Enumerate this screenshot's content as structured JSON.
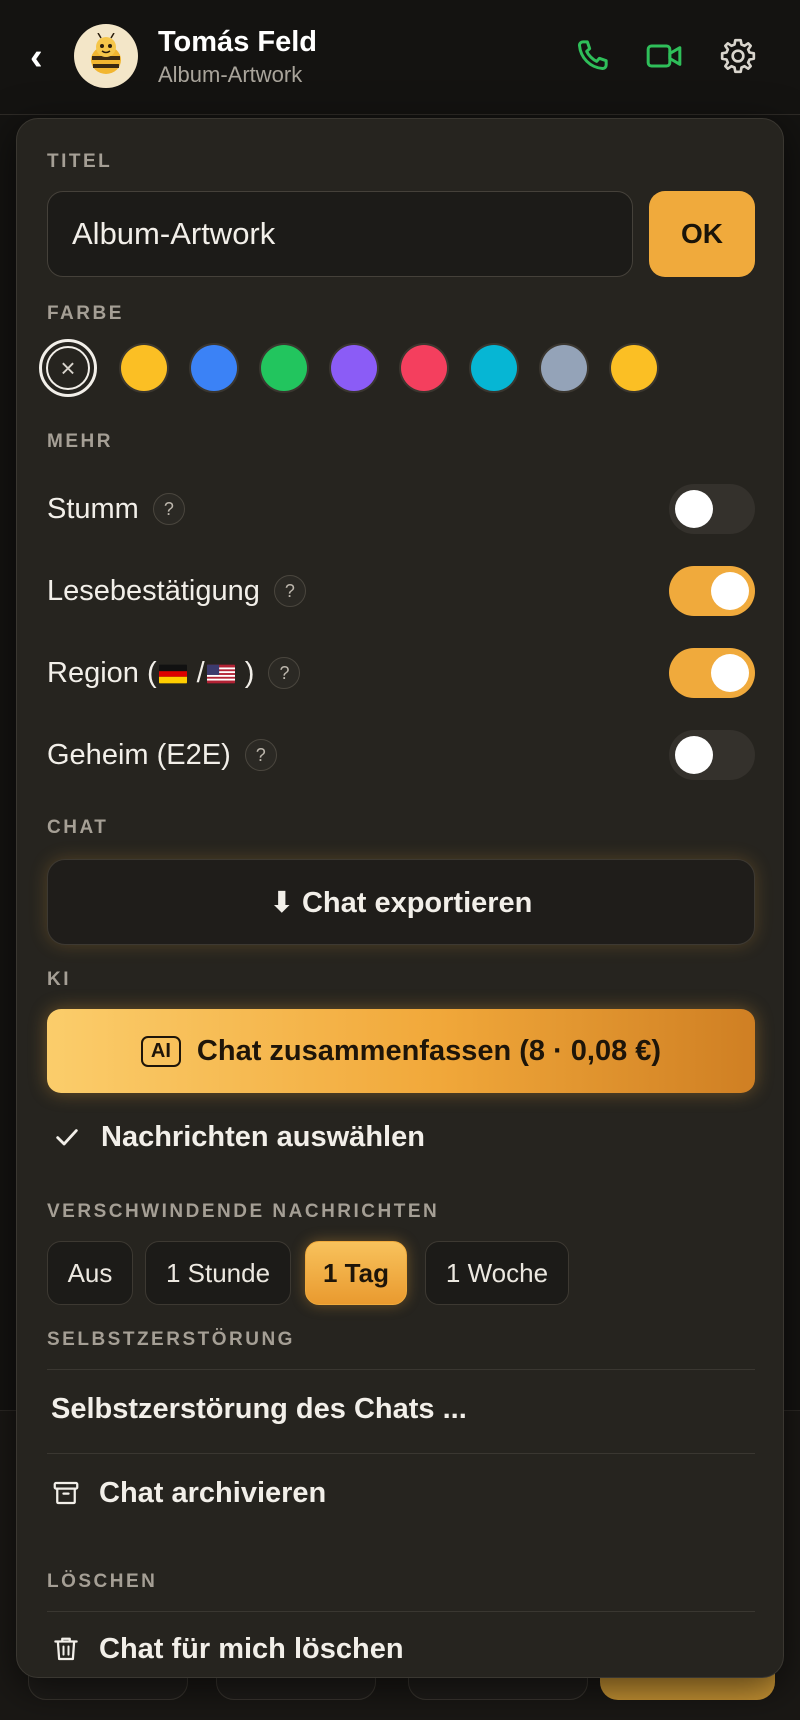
{
  "header": {
    "back_glyph": "‹",
    "name": "Tomás Feld",
    "subtitle": "Album-Artwork",
    "icons": [
      "phone-icon",
      "video-icon",
      "gear-icon"
    ],
    "accent_green": "#2fbf5a"
  },
  "panel": {
    "title_section": {
      "label": "TITEL",
      "input_value": "Album-Artwork",
      "ok_label": "OK"
    },
    "color_section": {
      "label": "FARBE",
      "swatches": [
        "none",
        "#fbbf24",
        "#3b82f6",
        "#22c55e",
        "#8b5cf6",
        "#f43f5e",
        "#06b6d4",
        "#94a3b8",
        "#fbbf24"
      ],
      "selected": "none"
    },
    "more_section": {
      "label": "MEHR",
      "toggles": [
        {
          "label": "Stumm",
          "on": false
        },
        {
          "label": "Lesebestätigung",
          "on": true
        },
        {
          "label_prefix": "Region (",
          "label_mid": " /",
          "label_suffix": " )",
          "on": true
        },
        {
          "label": "Geheim (E2E)",
          "on": false
        }
      ],
      "help_glyph": "?"
    },
    "chat_section": {
      "label": "CHAT",
      "export_label": "⬇ Chat exportieren"
    },
    "ai_section": {
      "label": "KI",
      "badge": "AI",
      "summarize_label": "Chat zusammenfassen (8 · 0,08 €)",
      "select_label": "Nachrichten auswählen"
    },
    "disappearing_section": {
      "label": "VERSCHWINDENDE NACHRICHTEN",
      "options": [
        "Aus",
        "1 Stunde",
        "1 Tag",
        "1 Woche"
      ],
      "selected": "1 Tag"
    },
    "selfdestruct_section": {
      "label": "SELBSTZERSTÖRUNG",
      "item_label": "Selbstzerstörung des Chats ...",
      "archive_label": "Chat archivieren"
    },
    "delete_section": {
      "label": "LÖSCHEN",
      "delete_label": "Chat für mich löschen"
    },
    "accent": "#f0aa3c"
  }
}
